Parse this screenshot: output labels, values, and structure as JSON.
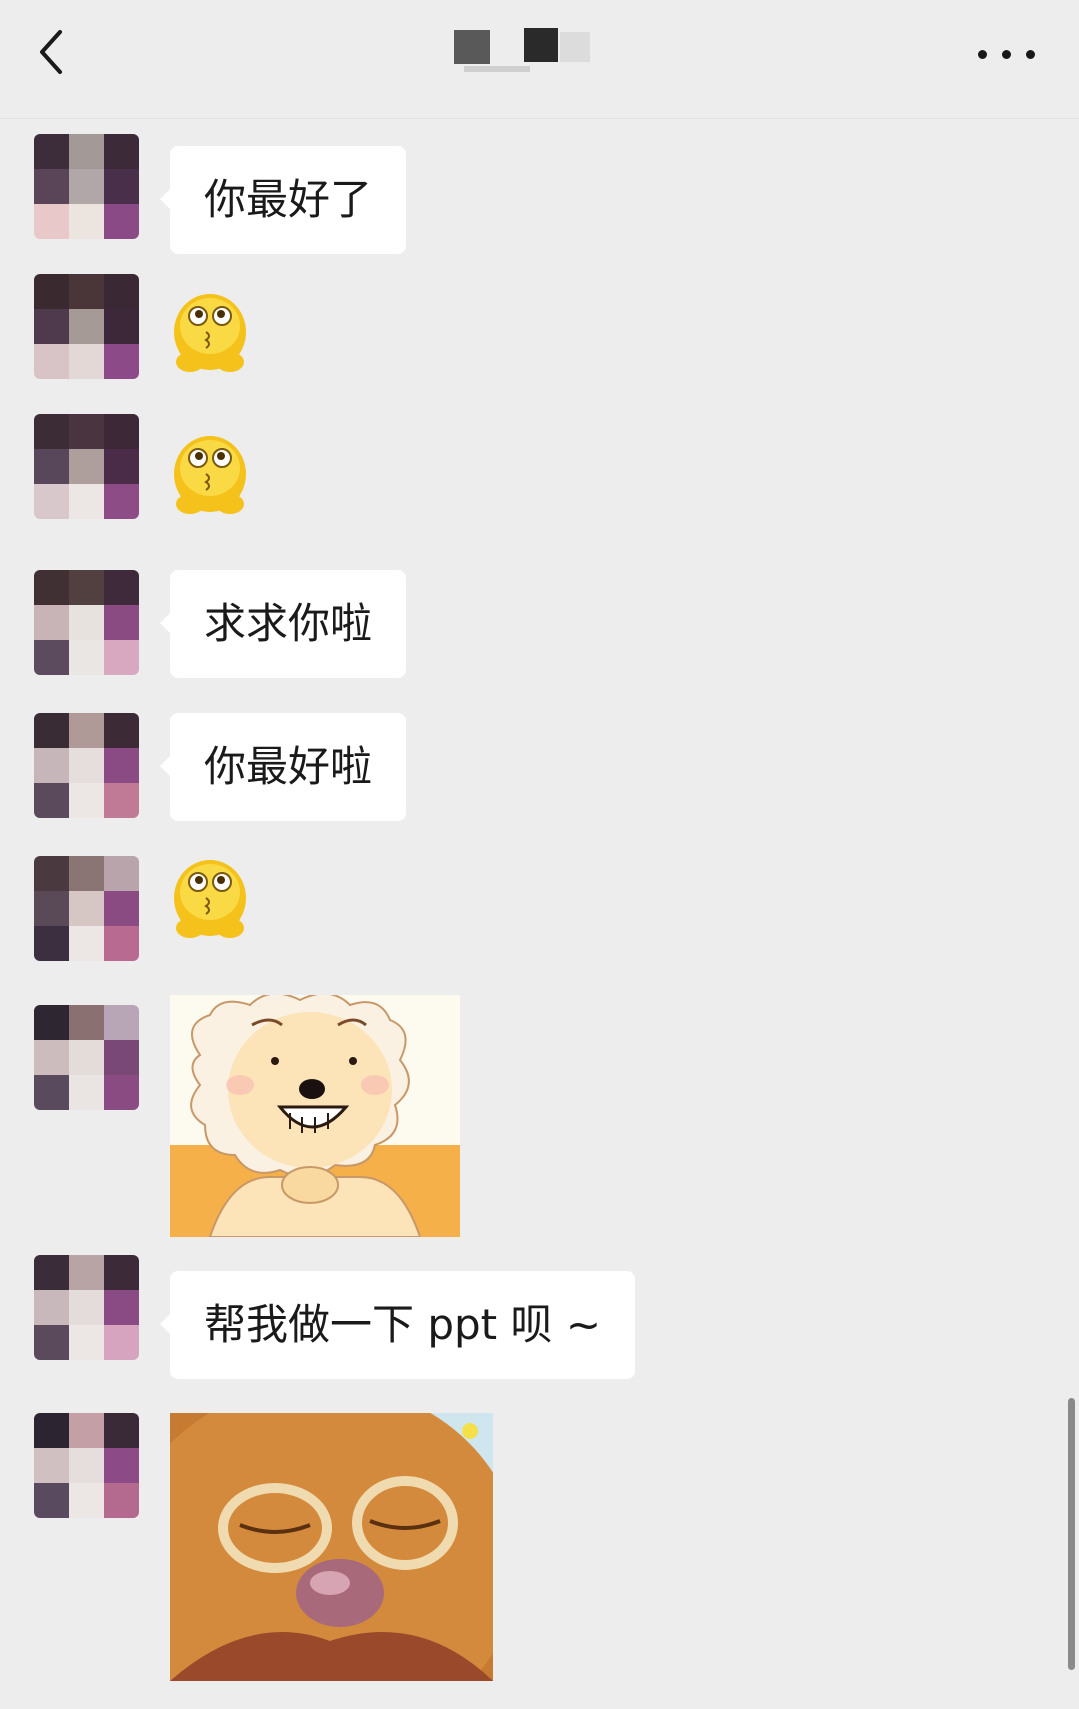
{
  "header": {
    "title": "",
    "back_icon": "chevron-left-icon",
    "more_icon": "more-horizontal-icon"
  },
  "messages": [
    {
      "type": "text",
      "text": "你最好了"
    },
    {
      "type": "emoji",
      "icon": "pleading-hug-emoji"
    },
    {
      "type": "emoji",
      "icon": "pleading-hug-emoji"
    },
    {
      "type": "text",
      "text": "求求你啦"
    },
    {
      "type": "text",
      "text": "你最好啦"
    },
    {
      "type": "emoji",
      "icon": "pleading-hug-emoji"
    },
    {
      "type": "sticker",
      "icon": "happy-sheep-sticker"
    },
    {
      "type": "text",
      "text": "帮我做一下 ppt 呗 ~"
    },
    {
      "type": "sticker",
      "icon": "bear-closeup-sticker"
    }
  ],
  "colors": {
    "background": "#ededed",
    "bubble": "#ffffff",
    "text": "#1a1a1a"
  }
}
